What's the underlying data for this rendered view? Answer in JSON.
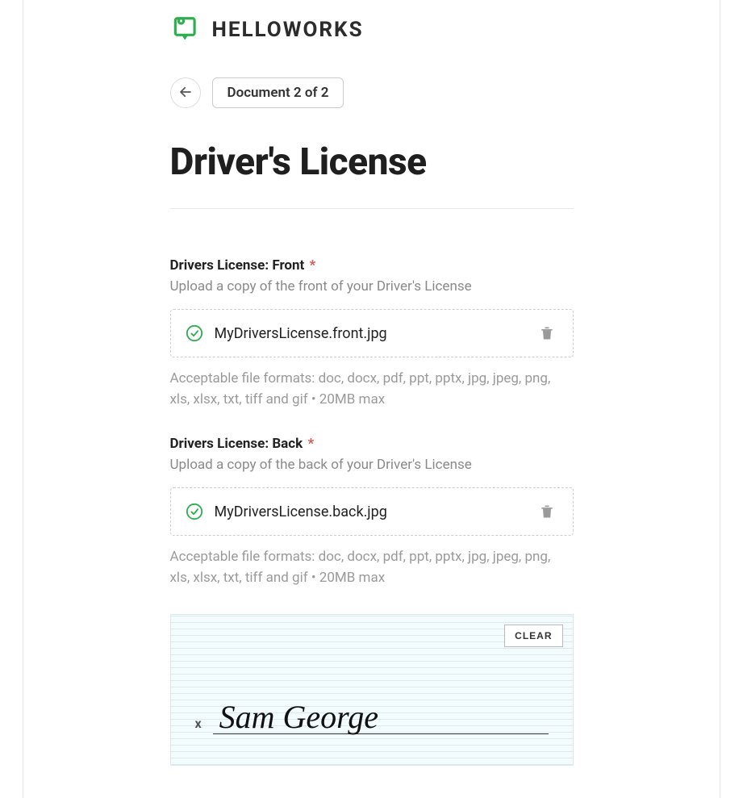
{
  "logo": {
    "text": "HELLOWORKS"
  },
  "nav": {
    "doc_badge": "Document 2 of 2"
  },
  "page_title": "Driver's License",
  "upload_front": {
    "label": "Drivers License: Front",
    "required_mark": "*",
    "hint": "Upload a copy of the front of your Driver's License",
    "file_name": "MyDriversLicense.front.jpg",
    "formats": "Acceptable file formats: doc, docx, pdf, ppt, pptx, jpg, jpeg, png, xls, xlsx, txt, tiff and gif • 20MB max"
  },
  "upload_back": {
    "label": "Drivers License: Back",
    "required_mark": "*",
    "hint": "Upload a copy of the back of your Driver's License",
    "file_name": "MyDriversLicense.back.jpg",
    "formats": "Acceptable file formats: doc, docx, pdf, ppt, pptx, jpg, jpeg, png, xls, xlsx, txt, tiff and gif • 20MB max"
  },
  "signature": {
    "clear_label": "CLEAR",
    "x_mark": "x",
    "value": "Sam George"
  }
}
